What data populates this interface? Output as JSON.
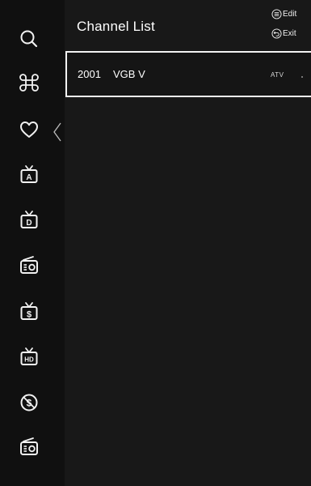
{
  "header": {
    "title": "Channel List",
    "edit_label": "Edit",
    "exit_label": "Exit"
  },
  "sidebar": {
    "items": [
      {
        "id": "search",
        "icon": "search-icon"
      },
      {
        "id": "command",
        "icon": "command-icon"
      },
      {
        "id": "favorites",
        "icon": "heart-icon"
      },
      {
        "id": "analog-tv",
        "icon": "tv-a-icon",
        "badge": "A"
      },
      {
        "id": "digital-tv",
        "icon": "tv-d-icon",
        "badge": "D"
      },
      {
        "id": "radio",
        "icon": "radio-icon"
      },
      {
        "id": "paid-tv",
        "icon": "tv-dollar-icon",
        "badge": "$"
      },
      {
        "id": "hd-tv",
        "icon": "tv-hd-icon",
        "badge": "HD"
      },
      {
        "id": "free",
        "icon": "no-dollar-icon"
      },
      {
        "id": "radio-2",
        "icon": "radio-icon"
      }
    ]
  },
  "channels": [
    {
      "number": "2001",
      "name": "VGB V",
      "type": "ATV"
    }
  ]
}
